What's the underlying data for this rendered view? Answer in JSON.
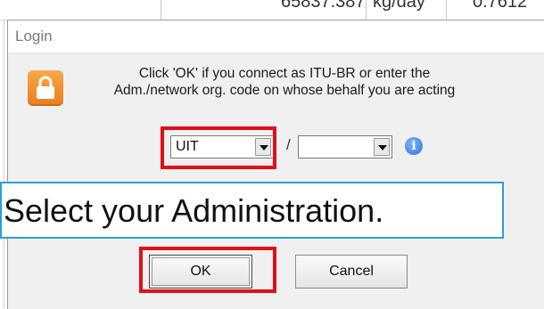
{
  "background_sheet": {
    "top_row_text": [
      "65837.387",
      "kg/day",
      "0.7612"
    ]
  },
  "dialog": {
    "title": "Login",
    "message_line1": "Click 'OK' if you connect as ITU-BR or enter the",
    "message_line2": "Adm./network org. code on whose behalf you are acting",
    "adm_combo_value": "UIT",
    "network_combo_value": "",
    "separator": "/",
    "ok_label": "OK",
    "cancel_label": "Cancel"
  },
  "annotation": {
    "callout_text": "Select your Administration.",
    "highlight_color": "#e0101a",
    "callout_border_color": "#29a0d8"
  },
  "icons": {
    "lock": "lock-icon",
    "info": "info-icon",
    "dropdown": "chevron-down-icon"
  }
}
